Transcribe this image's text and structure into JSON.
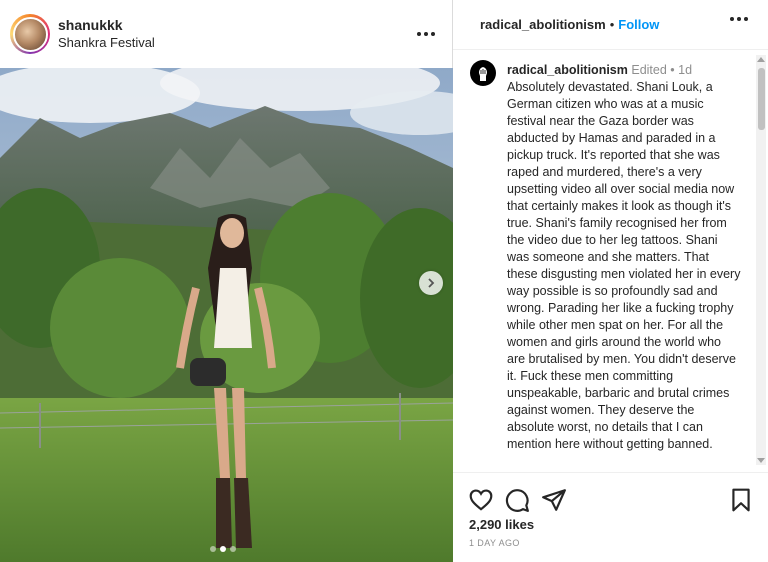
{
  "post": {
    "author": "shanukkk",
    "location": "Shankra Festival",
    "carousel": {
      "current_index": 1,
      "total": 3
    }
  },
  "comment_panel": {
    "header_username": "radical_abolitionism",
    "separator": "•",
    "follow_label": "Follow",
    "caption": {
      "username": "radical_abolitionism",
      "edited_label": "Edited",
      "meta_sep": "•",
      "time": "1d",
      "text": "Absolutely devastated. Shani Louk, a German citizen who was at a music festival near the Gaza border was abducted by Hamas and paraded in a pickup truck. It's reported that she was raped and murdered, there's a very upsetting video all over social media now that certainly makes it look as though it's true. Shani's family recognised her from the video due to her leg tattoos. Shani was someone and she matters. That these disgusting men violated her in every way possible is so profoundly sad and wrong. Parading her like a fucking trophy while other men spat on her. For all the women and girls around the world who are brutalised by men. You didn't deserve it. Fuck these men committing unspeakable, barbaric and brutal crimes against women. They deserve the absolute worst, no details that I can mention here without getting banned."
    },
    "likes_label": "2,290 likes",
    "time_ago": "1 DAY AGO"
  },
  "icons": {
    "like": "heart-icon",
    "comment": "comment-icon",
    "share": "send-icon",
    "save": "bookmark-icon",
    "more": "more-horizontal-icon",
    "next": "chevron-right-icon"
  },
  "colors": {
    "follow_blue": "#0095f6",
    "text": "#262626",
    "muted": "#8e8e8e",
    "border": "#dbdbdb"
  }
}
